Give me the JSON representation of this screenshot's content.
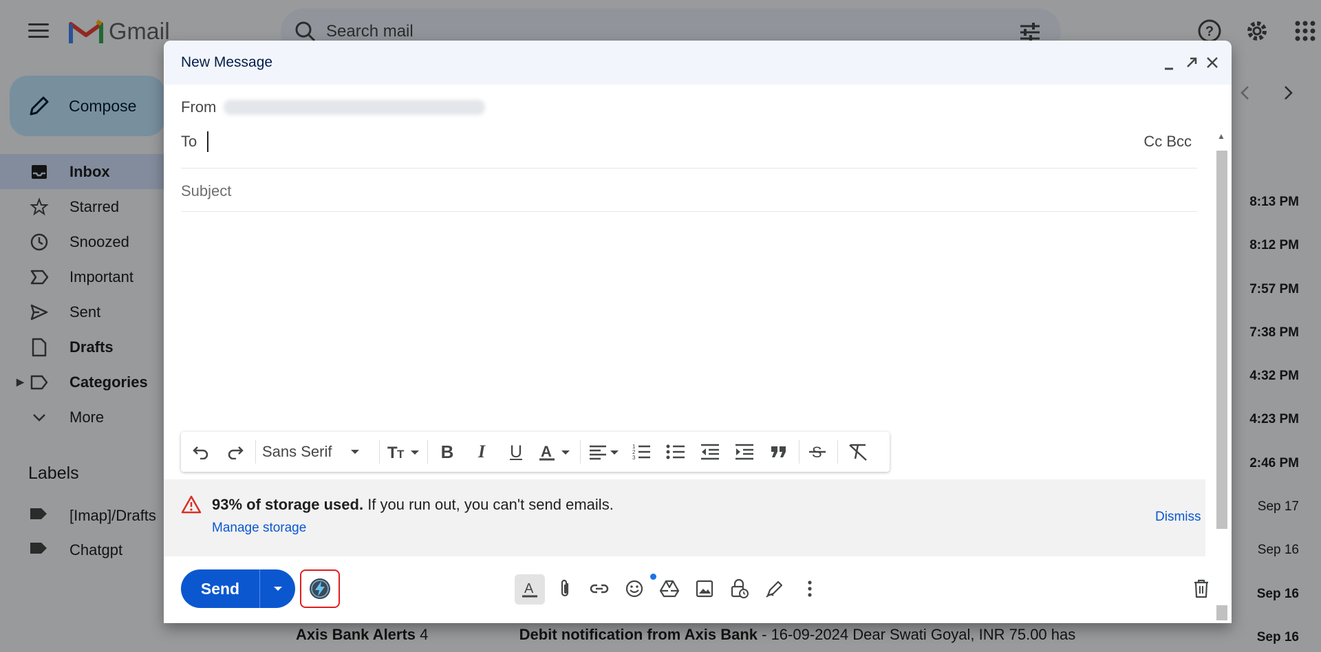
{
  "app": {
    "logo_text": "Gmail",
    "brand_colors": [
      "#ea4335",
      "#4285f4",
      "#34a853",
      "#fbbc04"
    ]
  },
  "search": {
    "placeholder": "Search mail"
  },
  "compose_button": {
    "label": "Compose"
  },
  "nav": {
    "items": [
      {
        "label": "Inbox",
        "icon": "inbox-icon"
      },
      {
        "label": "Starred",
        "icon": "star-icon"
      },
      {
        "label": "Snoozed",
        "icon": "clock-icon"
      },
      {
        "label": "Important",
        "icon": "important-icon"
      },
      {
        "label": "Sent",
        "icon": "send-icon"
      },
      {
        "label": "Drafts",
        "icon": "draft-icon"
      },
      {
        "label": "Categories",
        "icon": "label-icon"
      },
      {
        "label": "More",
        "icon": "chevron-down-icon"
      }
    ]
  },
  "labels": {
    "title": "Labels",
    "items": [
      {
        "label": "[Imap]/Drafts"
      },
      {
        "label": "Chatgpt"
      }
    ]
  },
  "mail_list": {
    "times": [
      "8:13 PM",
      "8:12 PM",
      "7:57 PM",
      "7:38 PM",
      "4:32 PM",
      "4:23 PM",
      "2:46 PM",
      "Sep 17",
      "Sep 16",
      "Sep 16",
      "Sep 16"
    ],
    "partial_row": {
      "sender": "Axis Bank Alerts",
      "count": "4",
      "subject": "Debit notification from Axis Bank",
      "snippet": "- 16-09-2024 Dear Swati Goyal, INR 75.00 has"
    }
  },
  "compose": {
    "title": "New Message",
    "from_label": "From",
    "to_label": "To",
    "cc_bcc": "Cc Bcc",
    "subject_placeholder": "Subject",
    "font_name": "Sans Serif",
    "storage": {
      "bold": "93% of storage used.",
      "text": " If you run out, you can't send emails.",
      "manage": "Manage storage",
      "dismiss": "Dismiss"
    },
    "send_label": "Send",
    "accent_color": "#0b57d0"
  }
}
